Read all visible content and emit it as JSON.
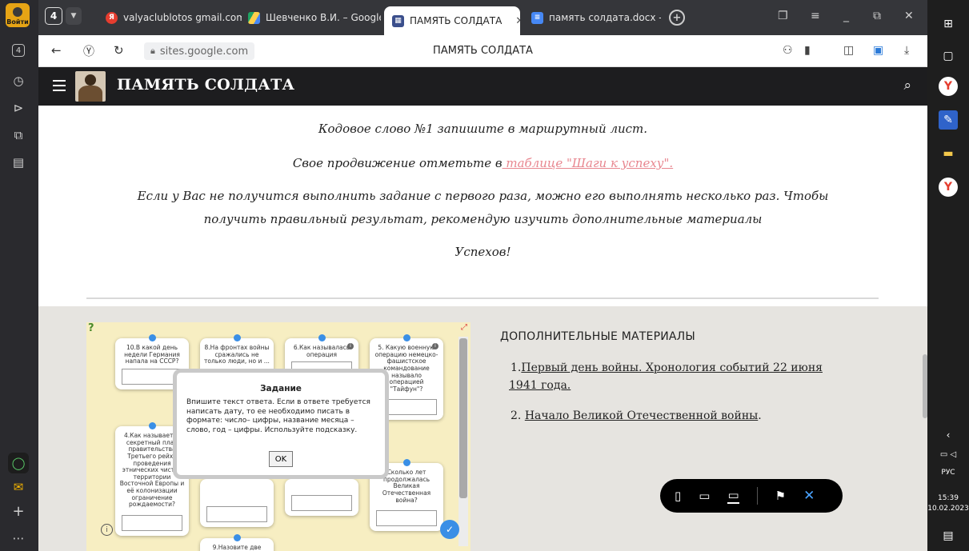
{
  "sidebar": {
    "login_label": "Войти"
  },
  "tabs": {
    "count": "4",
    "items": [
      {
        "label": "valyaclublotos gmail.com -",
        "favicon": "yandex-mail-icon"
      },
      {
        "label": "Шевченко В.И. – Google /",
        "favicon": "google-drive-icon"
      },
      {
        "label": "ПАМЯТЬ СОЛДАТА",
        "favicon": "google-sites-icon"
      },
      {
        "label": "память солдата.docx - Goo",
        "favicon": "google-docs-icon"
      }
    ]
  },
  "address": {
    "url": "sites.google.com",
    "page_title": "ПАМЯТЬ СОЛДАТА"
  },
  "site": {
    "title": "ПАМЯТЬ СОЛДАТА"
  },
  "content": {
    "line1": "Кодовое слово №1 запишите в маршрутный лист.",
    "line2_prefix": "Свое продвижение отметьте в",
    "line2_link": " таблице \"Шаги к успеху\".",
    "line3a": "Если у Вас не получится выполнить задание с первого раза, можно его выполнять несколько раз. Чтобы",
    "line3b": "получить правильный результат, рекомендую изучить дополнительные материалы",
    "line4": "Успехов!"
  },
  "exercise": {
    "cards": {
      "c10": "10.В какой день недели Германия напала на СССР?",
      "c8": "8.На фронтах войны сражались не только люди, но и ...",
      "c6": "6.Как называлась операция",
      "c5": "5. Какую военную операцию немецко-фашистское командование называло операцией \"Тайфун\"?",
      "c4": "4.Как называется секретный план правительства Третьего рейха проведения этнических чисток территории Восточной Европы и её колонизации ограничение рождаемости?",
      "c_long": "Сколько лет продолжалась Великая Отечественная война?",
      "c9": "9.Назовите две"
    },
    "dialog": {
      "title": "Задание",
      "text": "Впишите текст ответа. Если в ответе требуется написать дату, то ее необходимо писать в формате: число– цифры, название месяца – слово, год – цифры. Используйте подсказку.",
      "ok": "OK"
    }
  },
  "materials": {
    "heading": "ДОПОЛНИТЕЛЬНЫЕ МАТЕРИАЛЫ",
    "item1_num": "1.",
    "item1_a": "Первый день войны. Хронология событий 22 июня",
    "item1_b": "1941 года.",
    "item2_num": "2. ",
    "item2_link": "Начало Великой Отечественной войны",
    "item2_tail": "."
  },
  "taskbar": {
    "lang": "РУС",
    "time": "15:39",
    "date": "10.02.2023"
  },
  "colors": {
    "site_header": "#1d1d1f",
    "link_pink": "#e8868f",
    "accent_blue": "#3a8fe6"
  }
}
